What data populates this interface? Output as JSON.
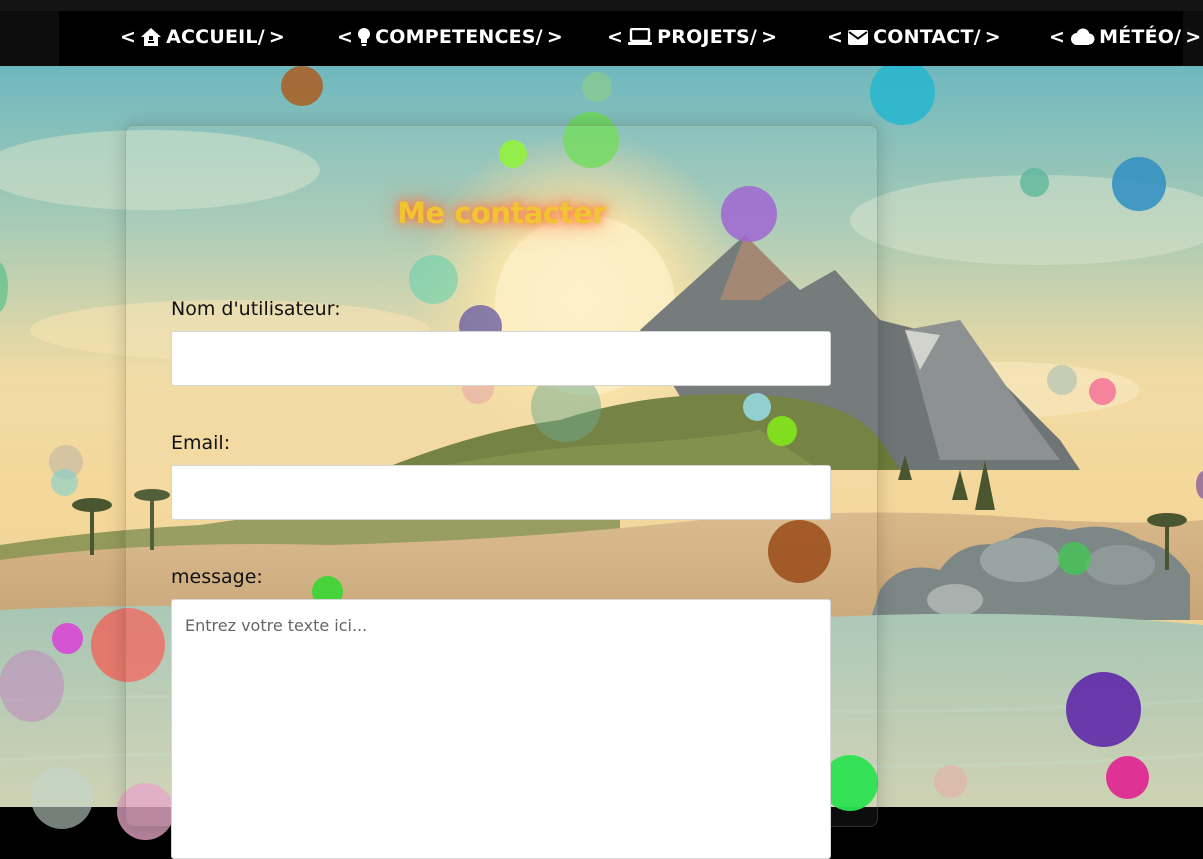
{
  "nav": {
    "items": [
      {
        "label": "ACCUEIL/",
        "icon": "home-icon"
      },
      {
        "label": "COMPETENCES/",
        "icon": "lightbulb-icon"
      },
      {
        "label": "PROJETS/",
        "icon": "laptop-icon"
      },
      {
        "label": "CONTACT/",
        "icon": "envelope-icon"
      },
      {
        "label": "MÉTÉO/",
        "icon": "cloud-icon"
      }
    ],
    "open_bracket": "<",
    "close_bracket": ">"
  },
  "form": {
    "title": "Me contacter",
    "username_label": "Nom d'utilisateur:",
    "email_label": "Email:",
    "message_label": "message:",
    "message_placeholder": "Entrez votre texte ici..."
  },
  "colors": {
    "title": "#f1c531",
    "title_glow": "#ff7a3c",
    "nav_background": "#000000",
    "nav_text": "#ffffff"
  }
}
